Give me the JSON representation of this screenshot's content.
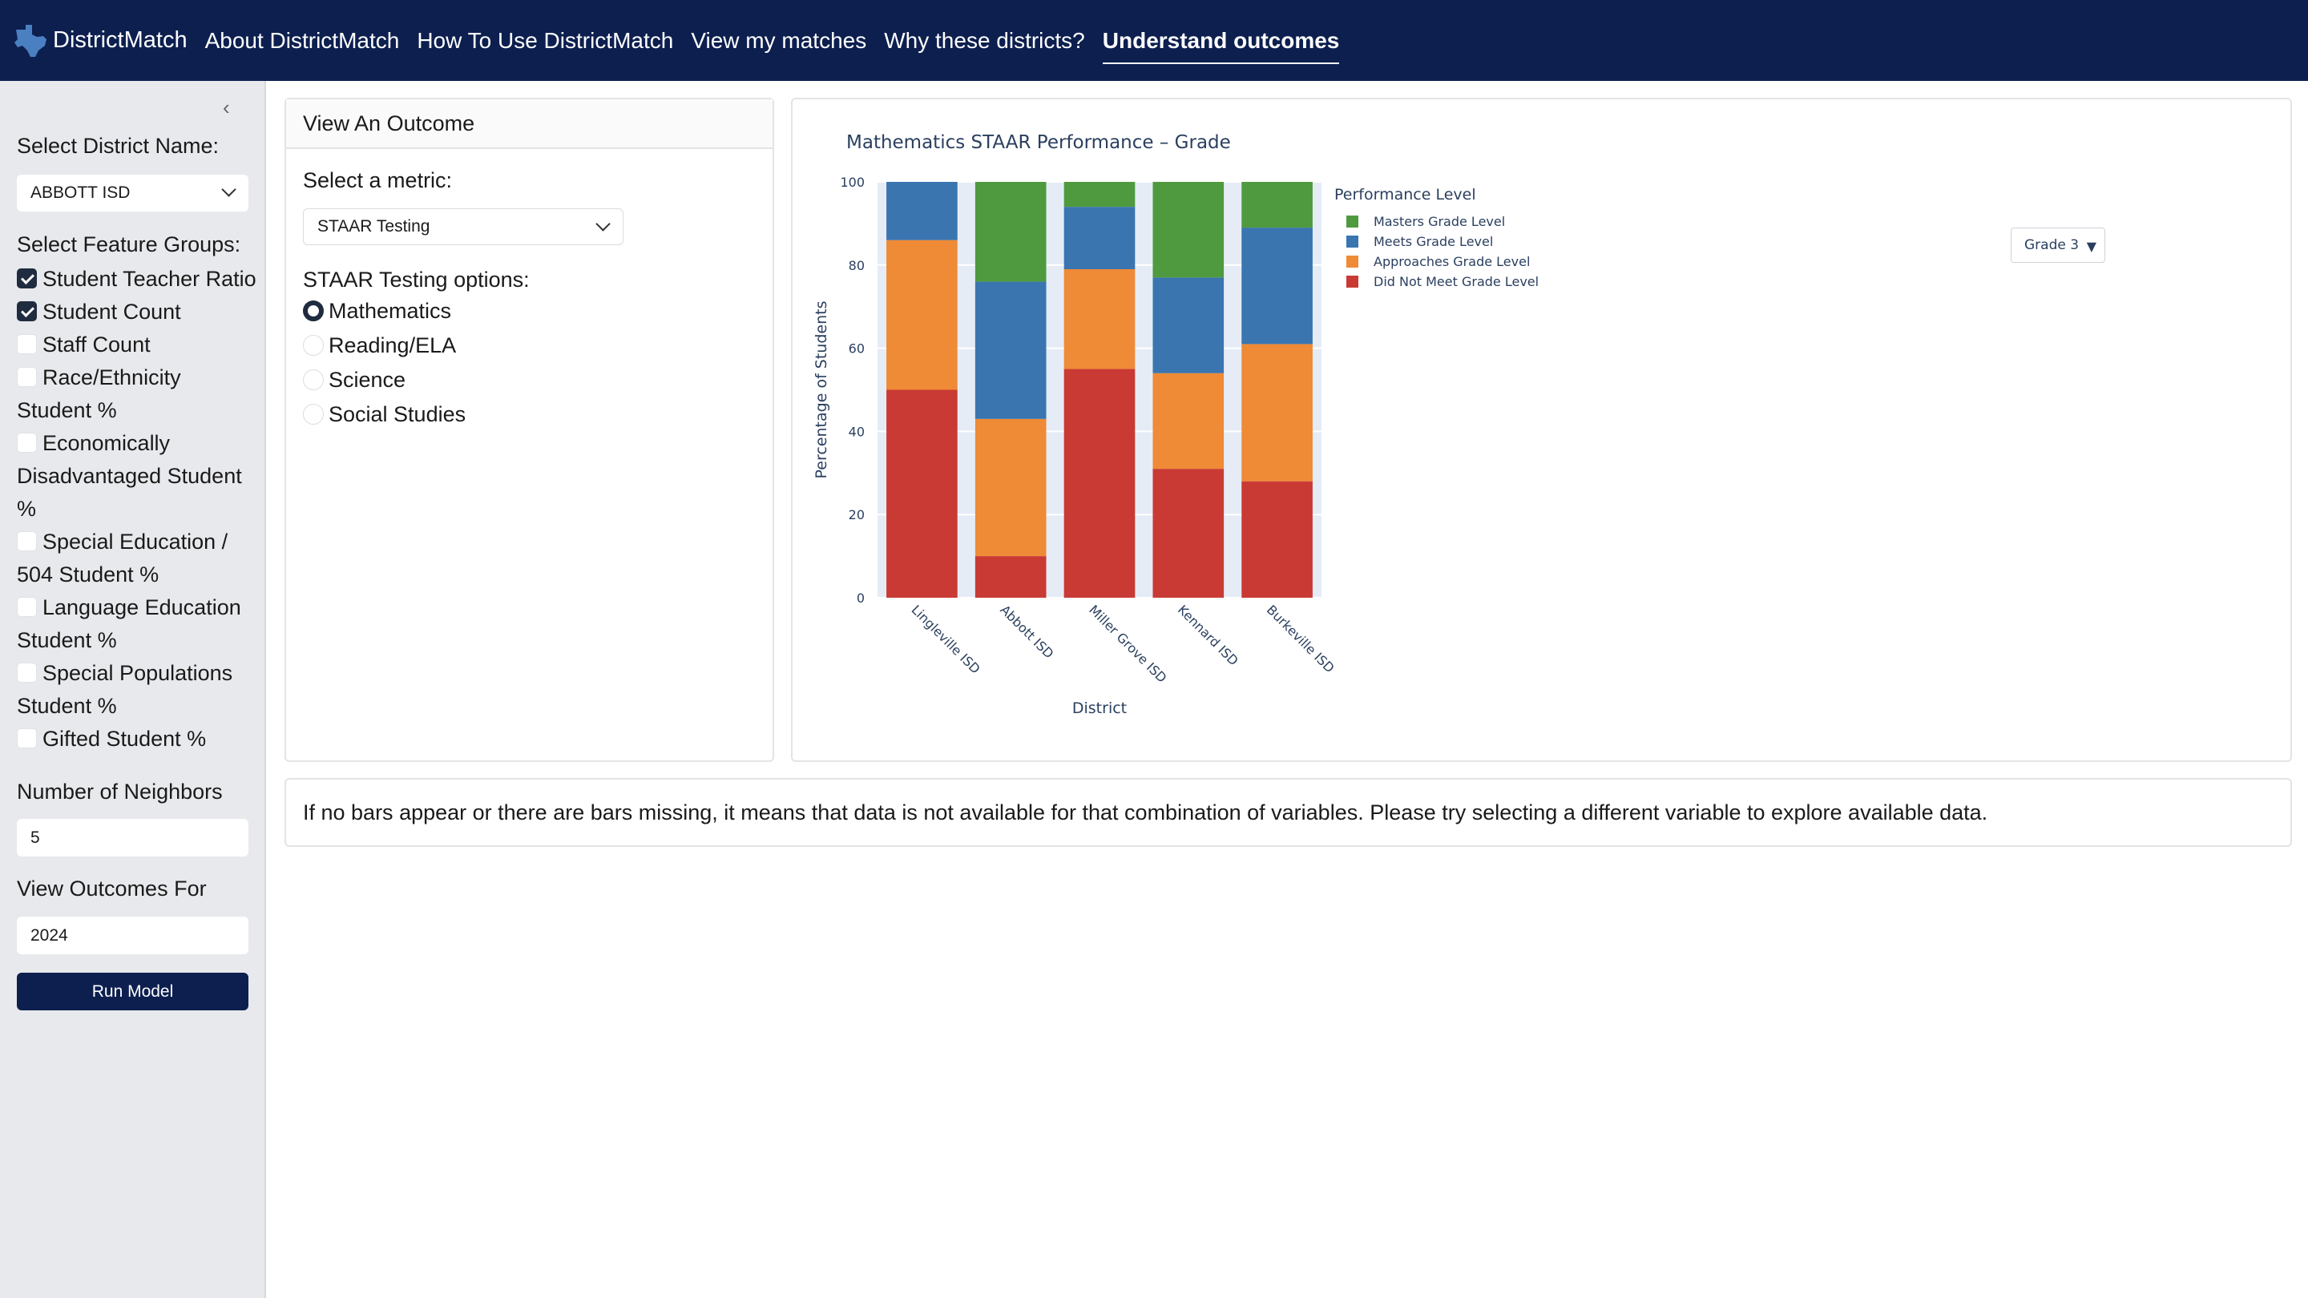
{
  "nav": {
    "brand": "DistrictMatch",
    "links": [
      "About DistrictMatch",
      "How To Use DistrictMatch",
      "View my matches",
      "Why these districts?",
      "Understand outcomes"
    ],
    "active_index": 4
  },
  "sidebar": {
    "district_label": "Select District Name:",
    "district_value": "ABBOTT ISD",
    "feature_label": "Select Feature Groups:",
    "features": [
      {
        "label": "Student Teacher Ratio",
        "checked": true
      },
      {
        "label": "Student Count",
        "checked": true
      },
      {
        "label": "Staff Count",
        "checked": false
      },
      {
        "label": "Race/Ethnicity Student %",
        "checked": false
      },
      {
        "label": "Economically Disadvantaged Student %",
        "checked": false
      },
      {
        "label": "Special Education / 504 Student %",
        "checked": false
      },
      {
        "label": "Language Education Student %",
        "checked": false
      },
      {
        "label": "Special Populations Student %",
        "checked": false
      },
      {
        "label": "Gifted Student %",
        "checked": false
      }
    ],
    "neighbors_label": "Number of Neighbors",
    "neighbors_value": "5",
    "outcomes_label": "View Outcomes For",
    "outcomes_value": "2024",
    "run_label": "Run Model"
  },
  "outcome_panel": {
    "title": "View An Outcome",
    "metric_label": "Select a metric:",
    "metric_value": "STAAR Testing",
    "options_label": "STAAR Testing options:",
    "options": [
      {
        "label": "Mathematics",
        "selected": true
      },
      {
        "label": "Reading/ELA",
        "selected": false
      },
      {
        "label": "Science",
        "selected": false
      },
      {
        "label": "Social Studies",
        "selected": false
      }
    ]
  },
  "grade_dropdown": "Grade 3",
  "chart_data": {
    "type": "bar",
    "stacked": true,
    "title": "Mathematics STAAR Performance – Grade",
    "xlabel": "District",
    "ylabel": "Percentage of Students",
    "ylim": [
      0,
      100
    ],
    "yticks": [
      0,
      20,
      40,
      60,
      80,
      100
    ],
    "categories": [
      "Lingleville ISD",
      "Abbott ISD",
      "Miller Grove ISD",
      "Kennard ISD",
      "Burkeville ISD"
    ],
    "legend_title": "Performance Level",
    "legend_position": "right",
    "legend_order": [
      "Masters Grade Level",
      "Meets Grade Level",
      "Approaches Grade Level",
      "Did Not Meet Grade Level"
    ],
    "series": [
      {
        "name": "Did Not Meet Grade Level",
        "color": "#c93a34",
        "values": [
          50,
          10,
          55,
          31,
          28
        ]
      },
      {
        "name": "Approaches Grade Level",
        "color": "#ef8a36",
        "values": [
          36,
          33,
          24,
          23,
          33
        ]
      },
      {
        "name": "Meets Grade Level",
        "color": "#3a75b0",
        "values": [
          14,
          33,
          15,
          23,
          28
        ]
      },
      {
        "name": "Masters Grade Level",
        "color": "#4f9a3f",
        "values": [
          0,
          24,
          6,
          23,
          11
        ]
      }
    ]
  },
  "note": "If no bars appear or there are bars missing, it means that data is not available for that combination of variables. Please try selecting a different variable to explore available data."
}
